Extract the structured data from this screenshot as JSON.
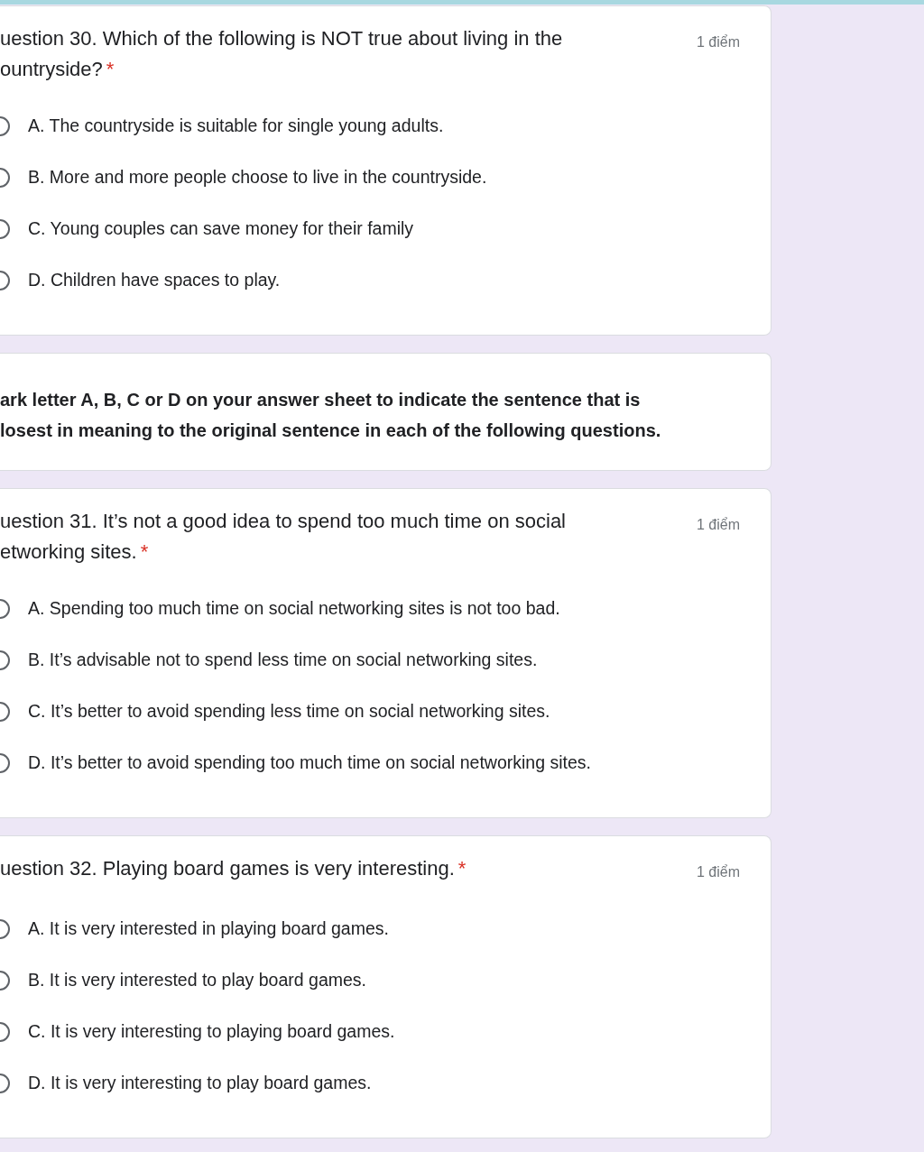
{
  "cards": [
    {
      "kind": "question",
      "title": "uestion 30. Which of the following is NOT true about living in the ountryside?",
      "required_mark": "*",
      "points": "1 điểm",
      "options": [
        {
          "label": "A. The countryside is suitable for single young adults.",
          "selected": false
        },
        {
          "label": "B. More and more people choose to live in the countryside.",
          "selected": false
        },
        {
          "label": "C. Young couples can save money for their family",
          "selected": false
        },
        {
          "label": "D. Children have spaces to play.",
          "selected": false
        }
      ]
    },
    {
      "kind": "text",
      "text": "ark letter A, B, C or D on your answer sheet to indicate the sentence that is losest in meaning to the original sentence in each of the following questions."
    },
    {
      "kind": "question",
      "title": "uestion 31. It’s not a good idea to spend too much time on social etworking sites.",
      "required_mark": "*",
      "points": "1 điểm",
      "options": [
        {
          "label": "A. Spending too much time on social networking sites is not too bad.",
          "selected": false
        },
        {
          "label": "B. It’s advisable not to spend less time on social networking sites.",
          "selected": false
        },
        {
          "label": "C. It’s better to avoid spending less time on social networking sites.",
          "selected": false
        },
        {
          "label": "D. It’s better to avoid spending too much time on social networking sites.",
          "selected": false
        }
      ]
    },
    {
      "kind": "question",
      "title": "uestion 32. Playing board games is very interesting.",
      "required_mark": "*",
      "points": "1 điểm",
      "options": [
        {
          "label": "A. It is very interested in playing board games.",
          "selected": false
        },
        {
          "label": "B. It is very interested to play board games.",
          "selected": false
        },
        {
          "label": "C. It is very interesting to playing board games.",
          "selected": false
        },
        {
          "label": "D. It is very interesting to play board games.",
          "selected": false
        }
      ]
    }
  ]
}
